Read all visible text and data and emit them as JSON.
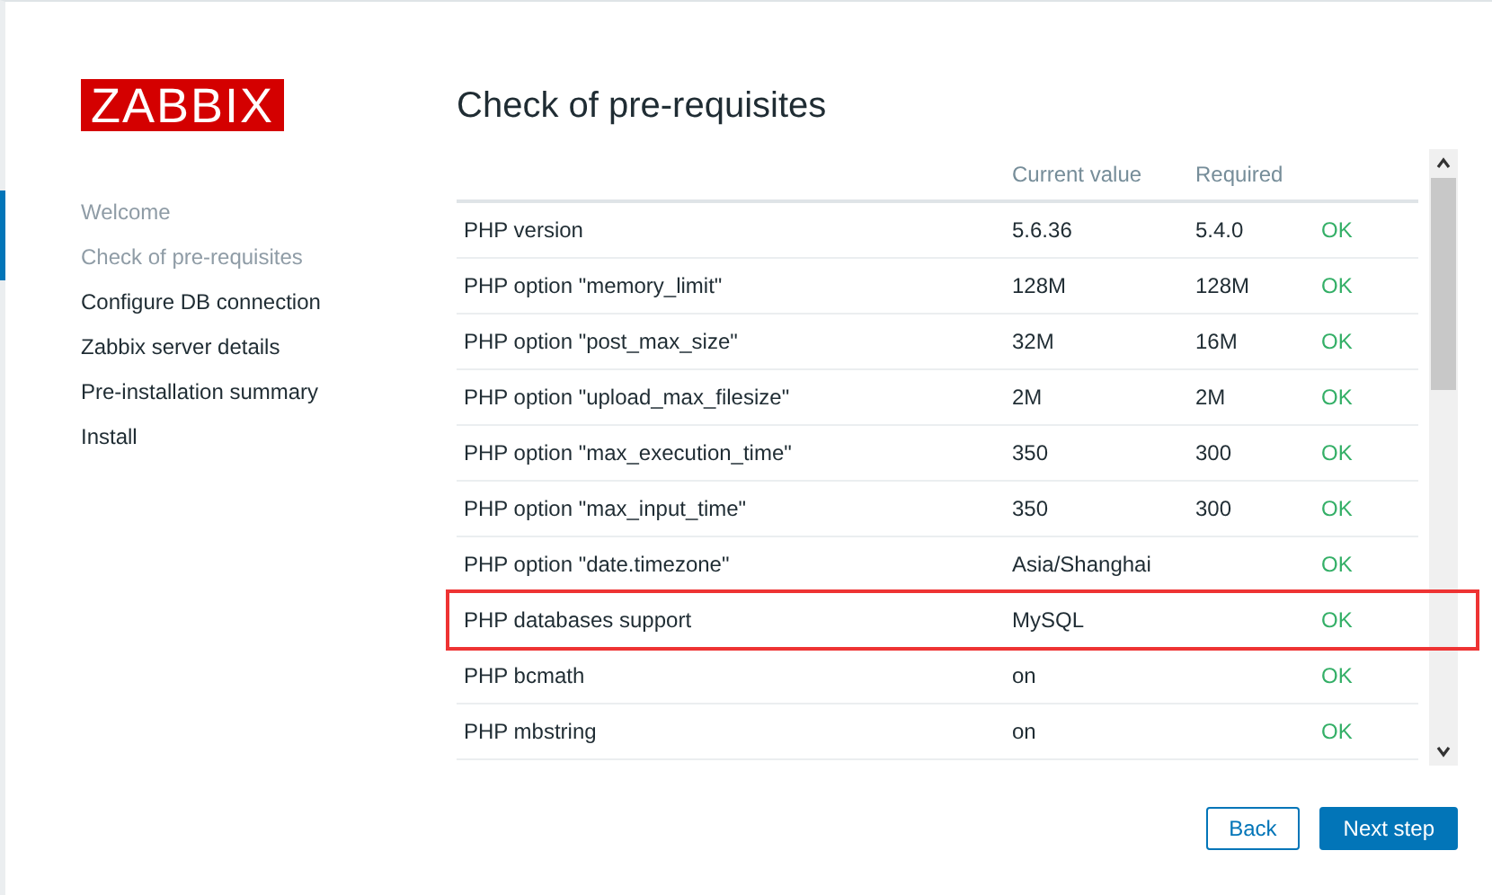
{
  "logo": "ZABBIX",
  "steps": [
    {
      "label": "Welcome",
      "done": true
    },
    {
      "label": "Check of pre-requisites",
      "done": true
    },
    {
      "label": "Configure DB connection",
      "done": false
    },
    {
      "label": "Zabbix server details",
      "done": false
    },
    {
      "label": "Pre-installation summary",
      "done": false
    },
    {
      "label": "Install",
      "done": false
    }
  ],
  "title": "Check of pre-requisites",
  "table": {
    "columns": [
      "Current value",
      "Required"
    ],
    "rows": [
      {
        "name": "PHP version",
        "current": "5.6.36",
        "required": "5.4.0",
        "status": "OK",
        "highlighted": false
      },
      {
        "name": "PHP option \"memory_limit\"",
        "current": "128M",
        "required": "128M",
        "status": "OK",
        "highlighted": false
      },
      {
        "name": "PHP option \"post_max_size\"",
        "current": "32M",
        "required": "16M",
        "status": "OK",
        "highlighted": false
      },
      {
        "name": "PHP option \"upload_max_filesize\"",
        "current": "2M",
        "required": "2M",
        "status": "OK",
        "highlighted": false
      },
      {
        "name": "PHP option \"max_execution_time\"",
        "current": "350",
        "required": "300",
        "status": "OK",
        "highlighted": false
      },
      {
        "name": "PHP option \"max_input_time\"",
        "current": "350",
        "required": "300",
        "status": "OK",
        "highlighted": false
      },
      {
        "name": "PHP option \"date.timezone\"",
        "current": "Asia/Shanghai",
        "status": "OK",
        "highlighted": false
      },
      {
        "name": "PHP databases support",
        "current": "MySQL",
        "status": "OK",
        "highlighted": true
      },
      {
        "name": "PHP bcmath",
        "current": "on",
        "status": "OK",
        "highlighted": false
      },
      {
        "name": "PHP mbstring",
        "current": "on",
        "status": "OK",
        "highlighted": false
      }
    ]
  },
  "buttons": [
    {
      "label": "Back",
      "kind": "secondary"
    },
    {
      "label": "Next step",
      "kind": "primary"
    }
  ]
}
